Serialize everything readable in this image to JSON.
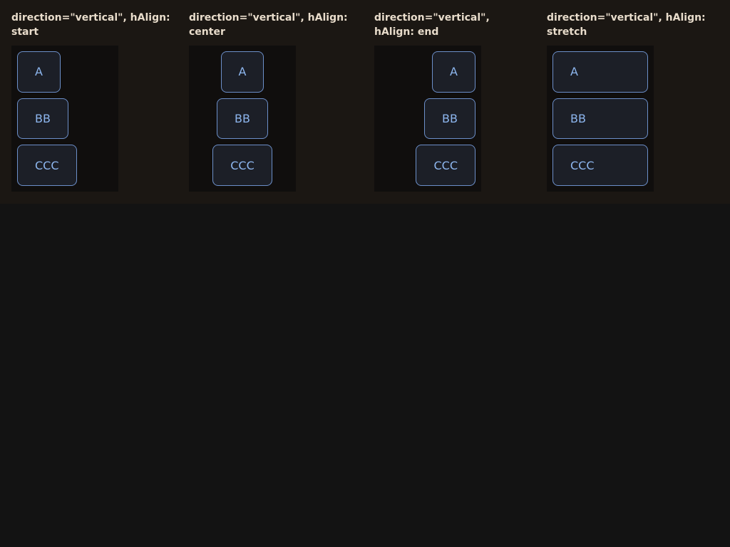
{
  "demos": [
    {
      "title": "direction=\"vertical\", hAlign: start",
      "items": [
        "A",
        "BB",
        "CCC"
      ]
    },
    {
      "title": "direction=\"vertical\", hAlign: center",
      "items": [
        "A",
        "BB",
        "CCC"
      ]
    },
    {
      "title": "direction=\"vertical\", hAlign: end",
      "items": [
        "A",
        "BB",
        "CCC"
      ]
    },
    {
      "title": "direction=\"vertical\", hAlign: stretch",
      "items": [
        "A",
        "BB",
        "CCC"
      ]
    }
  ],
  "colors": {
    "page_bg": "#131313",
    "panel_bg": "#1b1713",
    "stack_bg": "#100e0d",
    "box_bg": "#1c1f27",
    "box_border": "#6c8fc9",
    "box_text": "#8db6ee",
    "title_text": "#e8dccb"
  }
}
